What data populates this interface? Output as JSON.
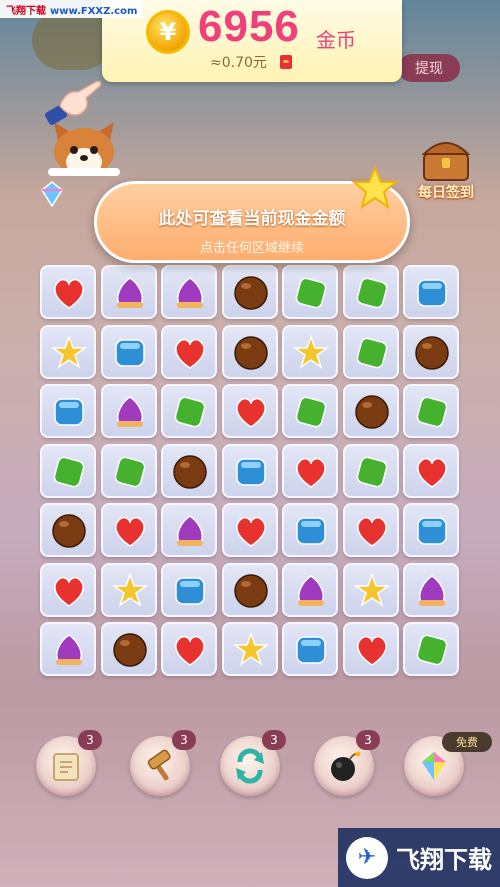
{
  "watermark_top": {
    "brand": "飞翔下载",
    "url": "www.FXXZ.com"
  },
  "coin_panel": {
    "coin_symbol": "¥",
    "amount": "6956",
    "unit": "金币",
    "cash_value": "≈0.70元"
  },
  "withdraw_button": "提现",
  "daily_checkin": "每日签到",
  "tooltip": {
    "title": "此处可查看当前现金金额",
    "subtitle": "点击任何区域继续"
  },
  "board": {
    "cols": 7,
    "rows": 7,
    "grid": [
      [
        "heart",
        "drop",
        "drop",
        "ball",
        "diamond",
        "diamond",
        "cube"
      ],
      [
        "star",
        "cube",
        "heart",
        "ball",
        "star",
        "diamond",
        "ball"
      ],
      [
        "cube",
        "drop",
        "diamond",
        "heart",
        "diamond",
        "ball",
        "diamond"
      ],
      [
        "diamond",
        "diamond",
        "ball",
        "cube",
        "heart",
        "diamond",
        "heart"
      ],
      [
        "ball",
        "heart",
        "drop",
        "heart",
        "cube",
        "heart",
        "cube"
      ],
      [
        "heart",
        "star",
        "cube",
        "ball",
        "drop",
        "star",
        "drop"
      ],
      [
        "drop",
        "ball",
        "heart",
        "star",
        "cube",
        "heart",
        "diamond"
      ]
    ],
    "piece_colors": {
      "heart": "#e8322f",
      "drop": "#a03bbf",
      "ball": "#7a3b12",
      "diamond": "#45b12e",
      "cube": "#2e8fd6",
      "star": "#f4c52c"
    }
  },
  "boosters": [
    {
      "name": "scroll",
      "count": "3"
    },
    {
      "name": "hammer",
      "count": "3"
    },
    {
      "name": "shuffle",
      "count": "3"
    },
    {
      "name": "bomb",
      "count": "3"
    },
    {
      "name": "rainbow",
      "count": ""
    }
  ],
  "free_label": "免费",
  "watermark_bottom": {
    "text": "飞翔下载"
  }
}
